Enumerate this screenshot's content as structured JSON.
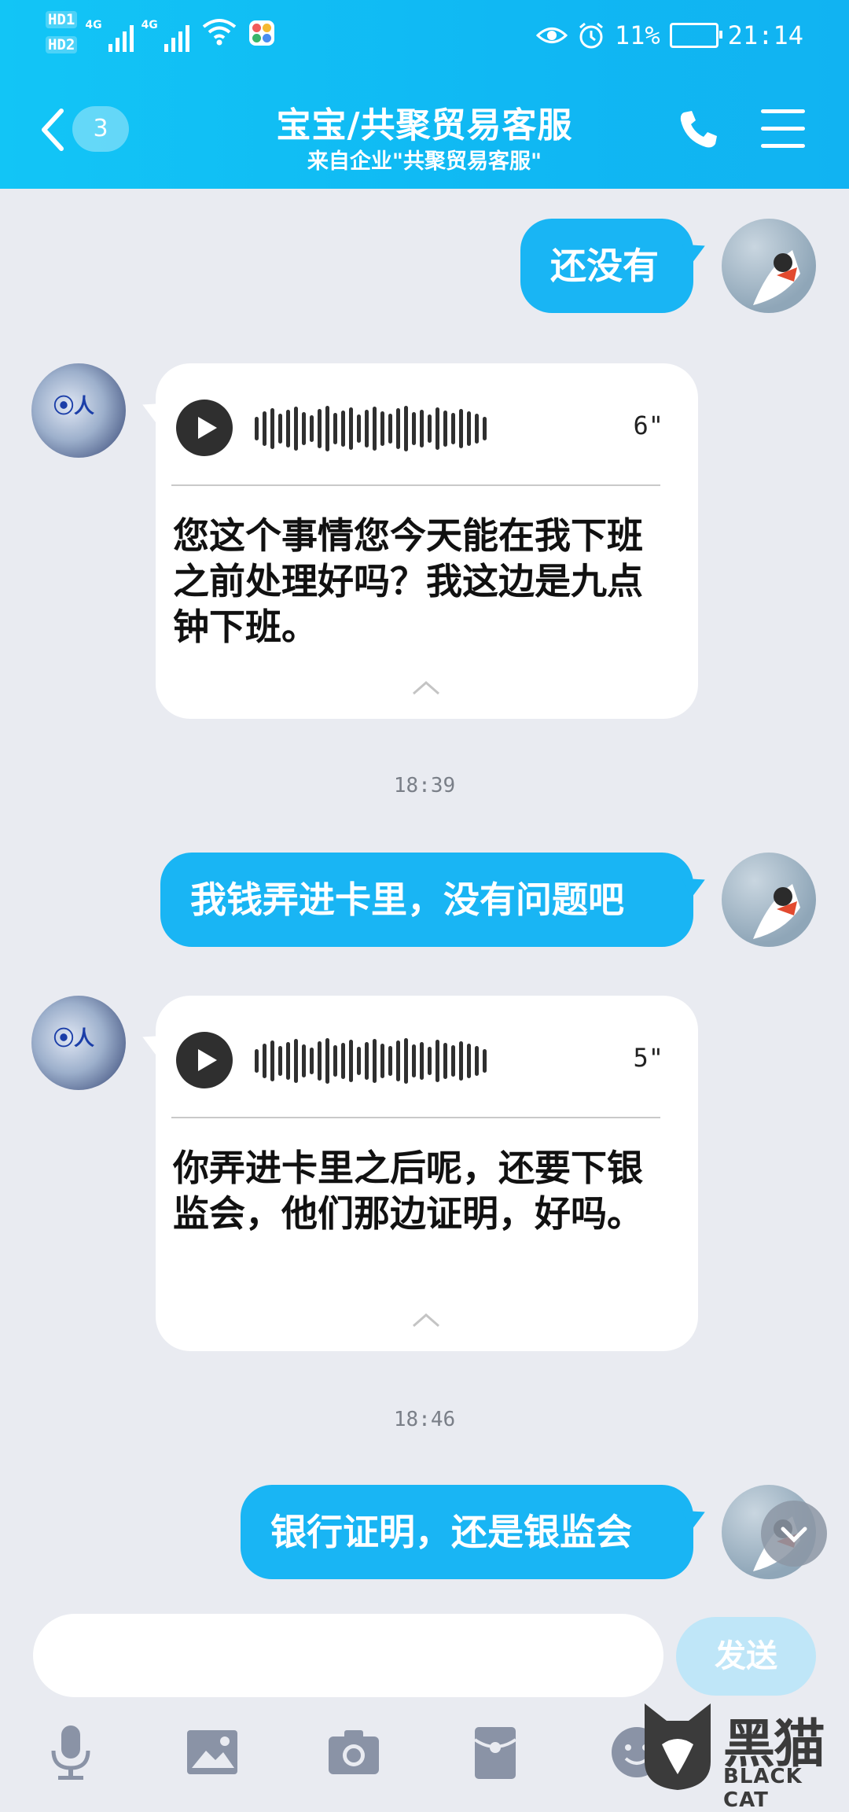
{
  "status_bar": {
    "hd1": "HD1",
    "hd2": "HD2",
    "net1": "4G",
    "net2": "4G",
    "battery_pct": "11%",
    "time": "21:14"
  },
  "header": {
    "unread_count": "3",
    "title": "宝宝/共聚贸易客服",
    "subtitle": "来自企业\"共聚贸易客服\""
  },
  "messages": {
    "m1": {
      "text": "还没有"
    },
    "m2": {
      "duration": "6\"",
      "transcript": "您这个事情您今天能在我下班之前处理好吗？我这边是九点钟下班。"
    },
    "t1": "18:39",
    "m3": {
      "text": "我钱弄进卡里，没有问题吧"
    },
    "m4": {
      "duration": "5\"",
      "transcript": "你弄进卡里之后呢，还要下银监会，他们那边证明，好吗。"
    },
    "t2": "18:46",
    "m5": {
      "text": "银行证明，还是银监会"
    }
  },
  "composer": {
    "send_label": "发送"
  },
  "toolbar": {
    "icons": [
      "mic-icon",
      "image-icon",
      "camera-icon",
      "red-packet-icon",
      "emoji-icon"
    ]
  },
  "watermark": {
    "cn": "黑猫",
    "en": "BLACK CAT"
  },
  "colors": {
    "header": "#12c5f6",
    "bubble_out": "#19b5f4",
    "background": "#e9ebf1"
  }
}
